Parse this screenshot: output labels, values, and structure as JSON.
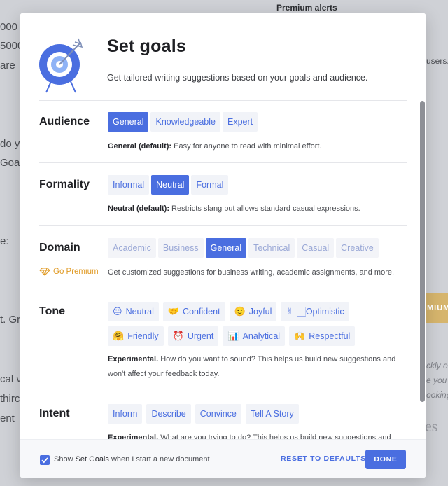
{
  "background": {
    "texts": [
      "000",
      "5000",
      " are",
      "Premium alerts",
      "users.",
      " do y",
      "Goa",
      "e:",
      "t. Gr",
      "MIUM",
      "ckly o",
      "e you s",
      "ooking",
      "cal v",
      "thirc",
      "ent",
      "es"
    ]
  },
  "modal": {
    "title": "Set goals",
    "subtitle": "Get tailored writing suggestions based on your goals and audience.",
    "sections": {
      "audience": {
        "label": "Audience",
        "options": [
          "General",
          "Knowledgeable",
          "Expert"
        ],
        "selected": "General",
        "desc_bold": "General (default):",
        "desc_text": " Easy for anyone to read with minimal effort."
      },
      "formality": {
        "label": "Formality",
        "options": [
          "Informal",
          "Neutral",
          "Formal"
        ],
        "selected": "Neutral",
        "desc_bold": "Neutral (default):",
        "desc_text": " Restricts slang but allows standard casual expressions."
      },
      "domain": {
        "label": "Domain",
        "premium_label": "Go Premium",
        "options": [
          "Academic",
          "Business",
          "General",
          "Technical",
          "Casual",
          "Creative"
        ],
        "selected": "General",
        "desc_text": "Get customized suggestions for business writing, academic assignments, and more."
      },
      "tone": {
        "label": "Tone",
        "options": [
          {
            "emoji": "😐",
            "label": "Neutral"
          },
          {
            "emoji": "🤝",
            "label": "Confident"
          },
          {
            "emoji": "🙂",
            "label": "Joyful"
          },
          {
            "emoji": "✌",
            "label": "🏻Optimistic"
          },
          {
            "emoji": "🤗",
            "label": "Friendly"
          },
          {
            "emoji": "⏰",
            "label": "Urgent"
          },
          {
            "emoji": "📊",
            "label": "Analytical"
          },
          {
            "emoji": "🙌",
            "label": "Respectful"
          }
        ],
        "desc_bold": "Experimental.",
        "desc_text": " How do you want to sound? This helps us build new suggestions and",
        "desc_text2": "won't affect your feedback today."
      },
      "intent": {
        "label": "Intent",
        "options": [
          "Inform",
          "Describe",
          "Convince",
          "Tell A Story"
        ],
        "desc_bold": "Experimental.",
        "desc_text": " What are you trying to do? This helps us build new suggestions and"
      }
    },
    "footer": {
      "checkbox_checked": true,
      "label_prefix": "Show ",
      "label_bold": "Set Goals",
      "label_suffix": " when I start a new document",
      "reset_label": "RESET TO DEFAULTS",
      "done_label": "DONE"
    },
    "colors": {
      "accent": "#4a6ee0",
      "chip_bg": "#f1f3f8",
      "premium": "#e09a24",
      "target_blue": "#4a6ee0"
    }
  }
}
